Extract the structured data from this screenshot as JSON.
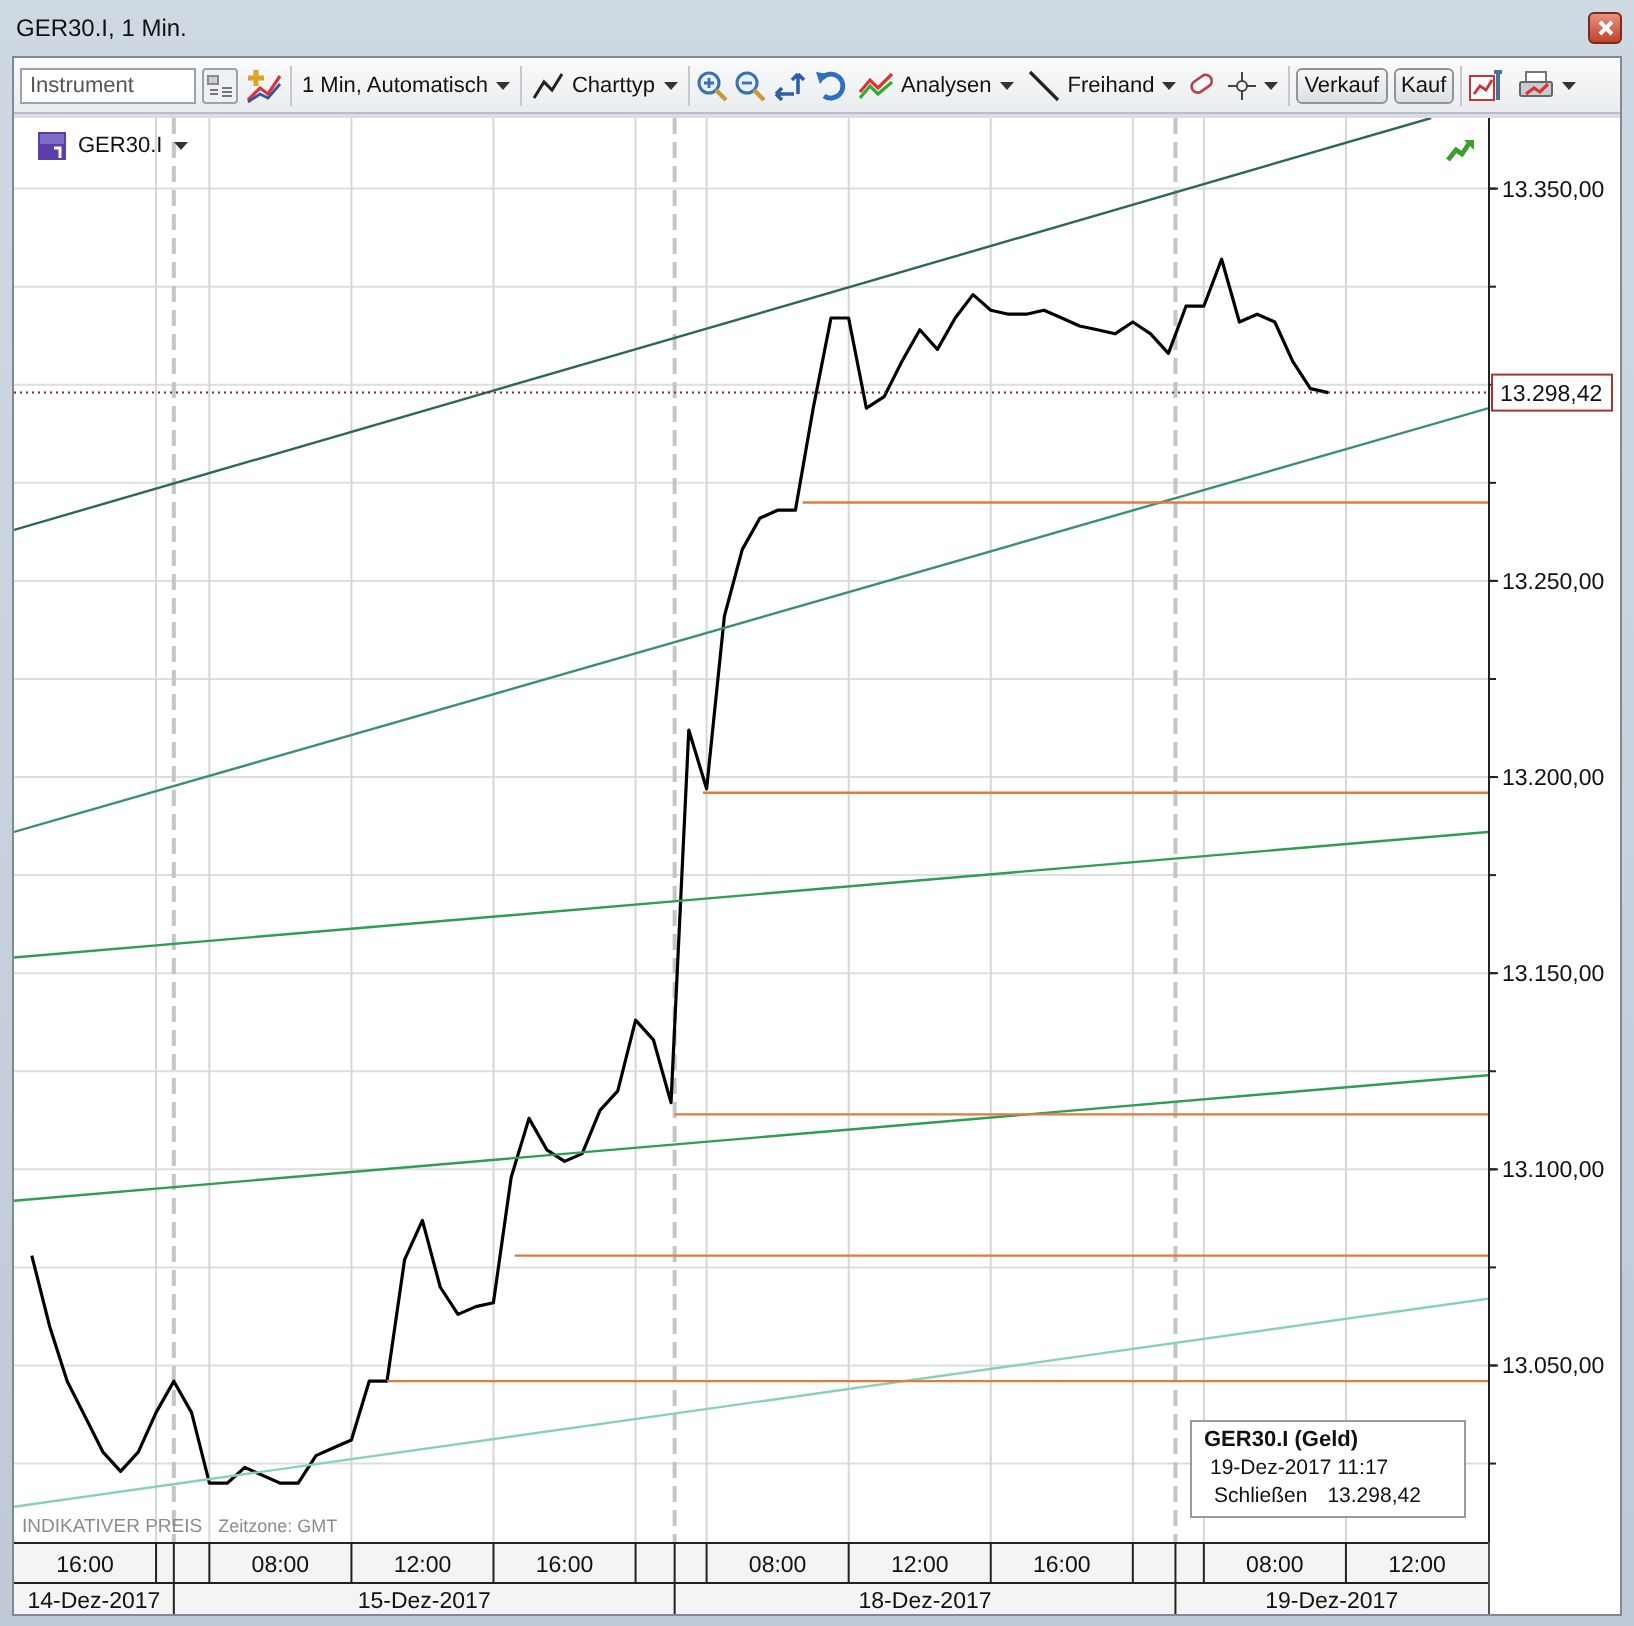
{
  "window": {
    "title": "GER30.I, 1 Min."
  },
  "toolbar": {
    "instrument_field": {
      "placeholder": "Instrument"
    },
    "interval": "1 Min, Automatisch",
    "chart_type": "Charttyp",
    "analyses": "Analysen",
    "freehand": "Freihand",
    "buttons": [
      "Verkauf",
      "Kauf"
    ]
  },
  "chart": {
    "footer_note": "INDIKATIVER PREIS",
    "timezone": "Zeitzone: GMT",
    "last_price": "13.298,42",
    "tooltip": {
      "title": "GER30.I (Geld)",
      "datetime": "19-Dez-2017 11:17",
      "field": "Schließen",
      "value": "13.298,42"
    },
    "day_labels": [
      "14-Dez-2017",
      "15-Dez-2017",
      "18-Dez-2017",
      "19-Dez-2017"
    ],
    "chart_data": {
      "type": "line",
      "ylim": [
        13005,
        13368
      ],
      "grid": true,
      "categories": [
        null,
        null,
        null,
        "16:00",
        null,
        null,
        null,
        null,
        null,
        null,
        null,
        null,
        null,
        null,
        "08:00",
        null,
        null,
        null,
        null,
        null,
        null,
        null,
        "12:00",
        null,
        null,
        null,
        null,
        null,
        null,
        null,
        "16:00",
        null,
        null,
        null,
        null,
        null,
        null,
        null,
        null,
        null,
        null,
        null,
        "08:00",
        null,
        null,
        null,
        null,
        null,
        null,
        null,
        "12:00",
        null,
        null,
        null,
        null,
        null,
        null,
        null,
        "16:00",
        null,
        null,
        null,
        null,
        null,
        null,
        null,
        null,
        null,
        null,
        null,
        "08:00",
        null,
        null,
        null,
        null,
        null,
        null,
        null,
        "12:00",
        null,
        null,
        null,
        null
      ],
      "yticks": [
        {
          "value": 13050,
          "label": "13.050,00"
        },
        {
          "value": 13100,
          "label": "13.100,00"
        },
        {
          "value": 13150,
          "label": "13.150,00"
        },
        {
          "value": 13200,
          "label": "13.200,00"
        },
        {
          "value": 13250,
          "label": "13.250,00"
        },
        {
          "value": 13350,
          "label": "13.350,00"
        }
      ],
      "series": [
        {
          "name": "GER30.I",
          "color": "#000000",
          "values": [
            13078,
            13060,
            13046,
            13037,
            13028,
            13023,
            13028,
            13038,
            13046,
            13038,
            13020,
            13020,
            13024,
            13022,
            13020,
            13020,
            13027,
            13029,
            13031,
            13046,
            13046,
            13077,
            13087,
            13070,
            13063,
            13065,
            13066,
            13098,
            13113,
            13105,
            13102,
            13104,
            13115,
            13120,
            13138,
            13133,
            13117,
            13212,
            13197,
            13241,
            13258,
            13266,
            13268,
            13268,
            13294,
            13317,
            13317,
            13294,
            13297,
            13306,
            13314,
            13309,
            13317,
            13323,
            13319,
            13318,
            13318,
            13319,
            13317,
            13315,
            13314,
            13313,
            13316,
            13313,
            13308,
            13320,
            13320,
            13332,
            13316,
            13318,
            13316,
            13306,
            13299,
            13298,
            null,
            null,
            null,
            null,
            null,
            null,
            null,
            null,
            null
          ]
        }
      ]
    }
  }
}
